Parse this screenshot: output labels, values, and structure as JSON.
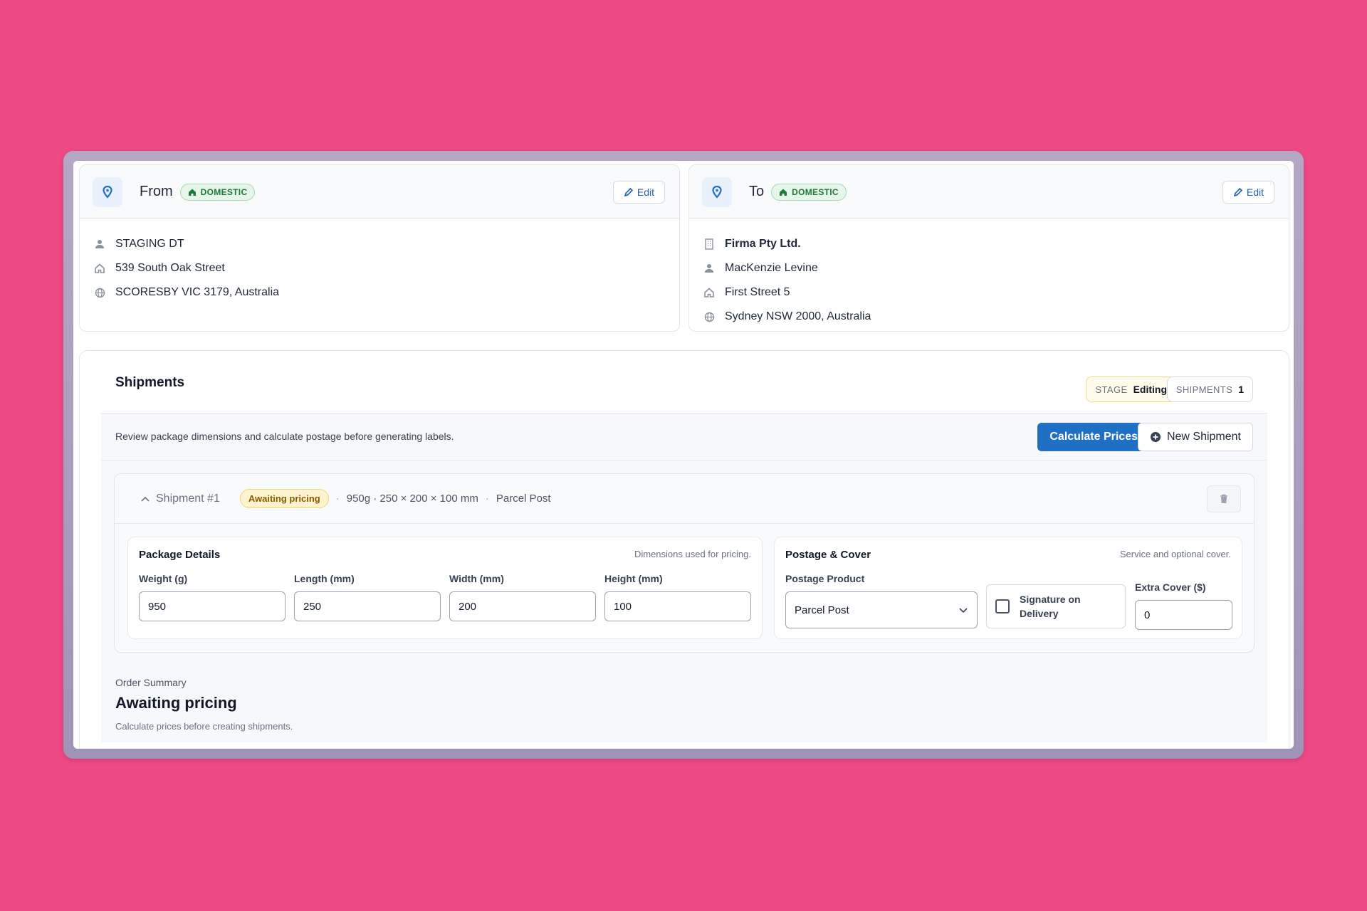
{
  "from": {
    "title": "From",
    "badge": "DOMESTIC",
    "edit_label": "Edit",
    "lines": [
      {
        "icon": "person-icon",
        "text": "STAGING DT"
      },
      {
        "icon": "home-icon",
        "text": "539 South Oak Street"
      },
      {
        "icon": "globe-icon",
        "text": "SCORESBY VIC 3179, Australia"
      }
    ]
  },
  "to": {
    "title": "To",
    "badge": "DOMESTIC",
    "edit_label": "Edit",
    "company": "Firma Pty Ltd.",
    "lines": [
      {
        "icon": "person-icon",
        "text": "MacKenzie Levine"
      },
      {
        "icon": "home-icon",
        "text": "First Street 5"
      },
      {
        "icon": "globe-icon",
        "text": "Sydney NSW 2000, Australia"
      }
    ]
  },
  "shipments": {
    "title": "Shipments",
    "stage_key": "STAGE",
    "stage_value": "Editing",
    "count_key": "SHIPMENTS",
    "count_value": "1",
    "toolbar_text": "Review package dimensions and calculate postage before generating labels.",
    "calculate_label": "Calculate Prices",
    "new_label": "New Shipment"
  },
  "shipment": {
    "name": "Shipment #1",
    "status": "Awaiting pricing",
    "dims_summary": "950g · 250 × 200 × 100 mm",
    "product_summary": "Parcel Post",
    "package": {
      "title": "Package Details",
      "hint": "Dimensions used for pricing.",
      "weight_label": "Weight (g)",
      "weight_value": "950",
      "length_label": "Length (mm)",
      "length_value": "250",
      "width_label": "Width (mm)",
      "width_value": "200",
      "height_label": "Height (mm)",
      "height_value": "100"
    },
    "postage": {
      "title": "Postage & Cover",
      "hint": "Service and optional cover.",
      "product_label": "Postage Product",
      "product_value": "Parcel Post",
      "signature_label": "Signature on Delivery",
      "signature_checked": false,
      "cover_label": "Extra Cover ($)",
      "cover_value": "0"
    }
  },
  "summary": {
    "label": "Order Summary",
    "title": "Awaiting pricing",
    "note": "Calculate prices before creating shipments."
  },
  "colors": {
    "background": "#ee4a86",
    "accent": "#1f6fc4",
    "domestic_badge": "#1e7a38",
    "awaiting_badge": "#8a5a00"
  }
}
